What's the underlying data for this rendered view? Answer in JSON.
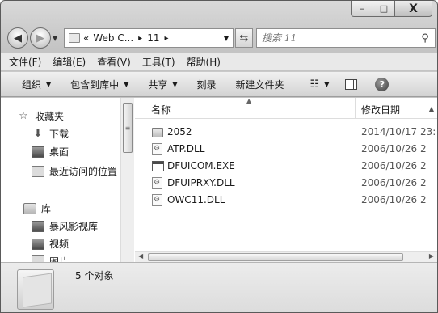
{
  "window": {
    "caption_buttons": {
      "minimize": "–",
      "maximize": "□",
      "close": "X"
    }
  },
  "address": {
    "back_icon": "◀",
    "forward_icon": "▶",
    "prefix": "«",
    "segment1": "Web C...",
    "segment2": "11",
    "sep": "▸",
    "refresh_icon": "⇆"
  },
  "search": {
    "placeholder": "搜索 11"
  },
  "menubar": {
    "items": [
      "文件(F)",
      "编辑(E)",
      "查看(V)",
      "工具(T)",
      "帮助(H)"
    ]
  },
  "commandbar": {
    "organize": "组织",
    "include_in_library": "包含到库中",
    "share": "共享",
    "burn": "刻录",
    "new_folder": "新建文件夹"
  },
  "nav_pane": {
    "favorites": "收藏夹",
    "downloads": "下载",
    "desktop": "桌面",
    "recent": "最近访问的位置",
    "libraries": "库",
    "storm": "暴风影视库",
    "video": "视频",
    "pictures": "图片"
  },
  "file_list": {
    "columns": {
      "name": "名称",
      "date": "修改日期"
    },
    "rows": [
      {
        "name": "2052",
        "date": "2014/10/17 23:",
        "type": "folder"
      },
      {
        "name": "ATP.DLL",
        "date": "2006/10/26 2",
        "type": "dll"
      },
      {
        "name": "DFUICOM.EXE",
        "date": "2006/10/26 2",
        "type": "exe"
      },
      {
        "name": "DFUIPRXY.DLL",
        "date": "2006/10/26 2",
        "type": "dll"
      },
      {
        "name": "OWC11.DLL",
        "date": "2006/10/26 2",
        "type": "dll"
      }
    ]
  },
  "details": {
    "count_text": "5 个对象"
  }
}
